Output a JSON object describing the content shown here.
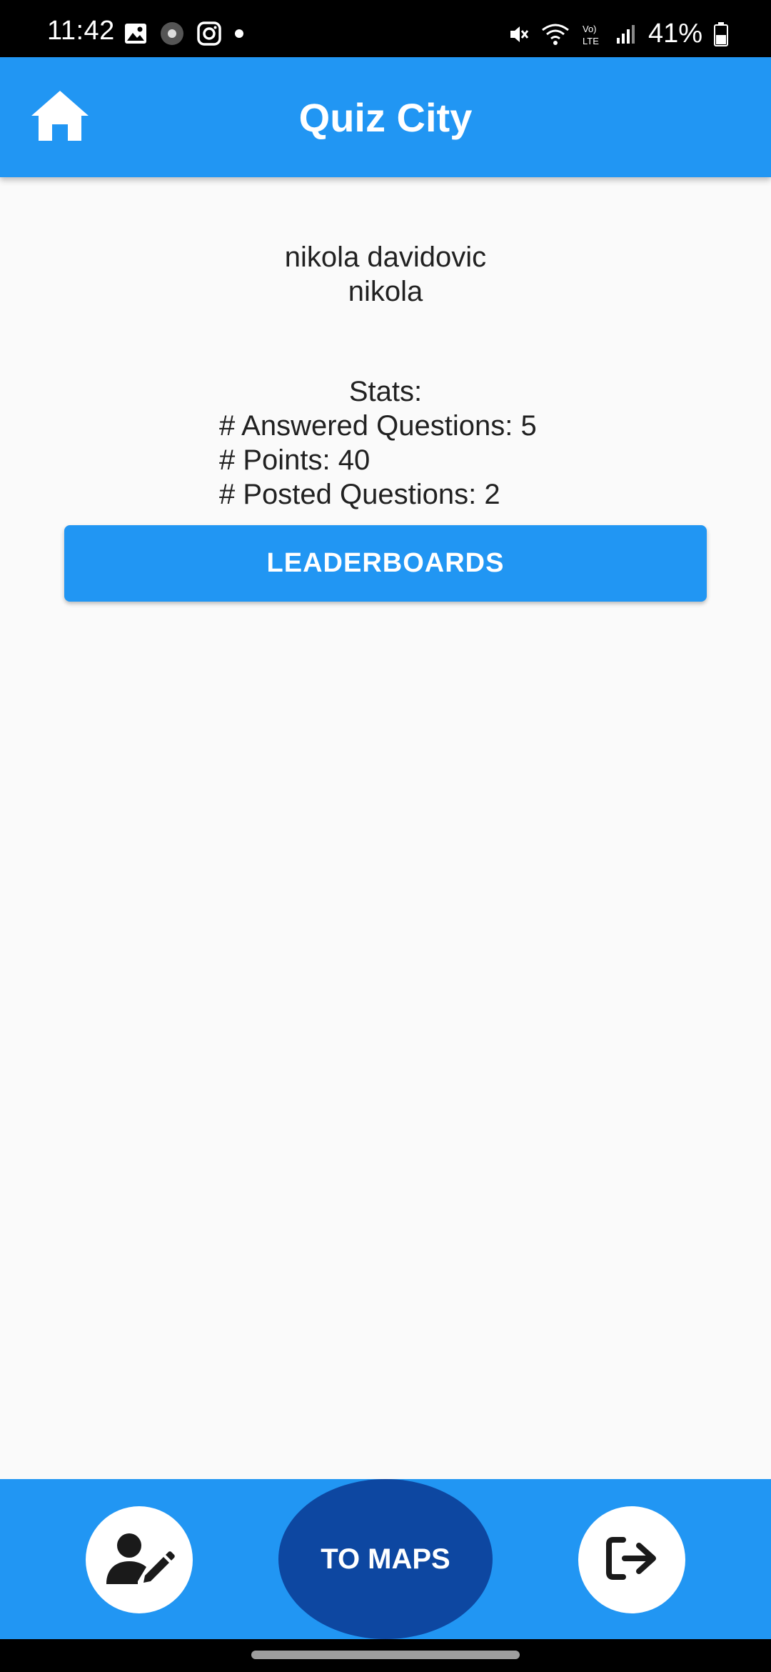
{
  "status_bar": {
    "time": "11:42",
    "battery": "41%",
    "left_icons": [
      "image-icon",
      "record-icon",
      "instagram-icon",
      "dot-icon"
    ],
    "right_icons": [
      "mute-icon",
      "wifi-icon",
      "volte-icon",
      "signal-icon",
      "battery-icon"
    ]
  },
  "app_bar": {
    "title": "Quiz City",
    "home_icon": "home-icon",
    "color": "#2196f3"
  },
  "profile": {
    "full_name": "nikola davidovic",
    "username": "nikola"
  },
  "stats": {
    "title": "Stats:",
    "answered": "# Answered Questions: 5",
    "points": "# Points: 40",
    "posted": "# Posted Questions: 2"
  },
  "leaderboards_button": {
    "label": "LEADERBOARDS"
  },
  "bottom_bar": {
    "to_maps_label": "TO MAPS",
    "edit_profile_icon": "edit-profile-icon",
    "logout_icon": "logout-icon",
    "accent_dark": "#0d47a1"
  }
}
